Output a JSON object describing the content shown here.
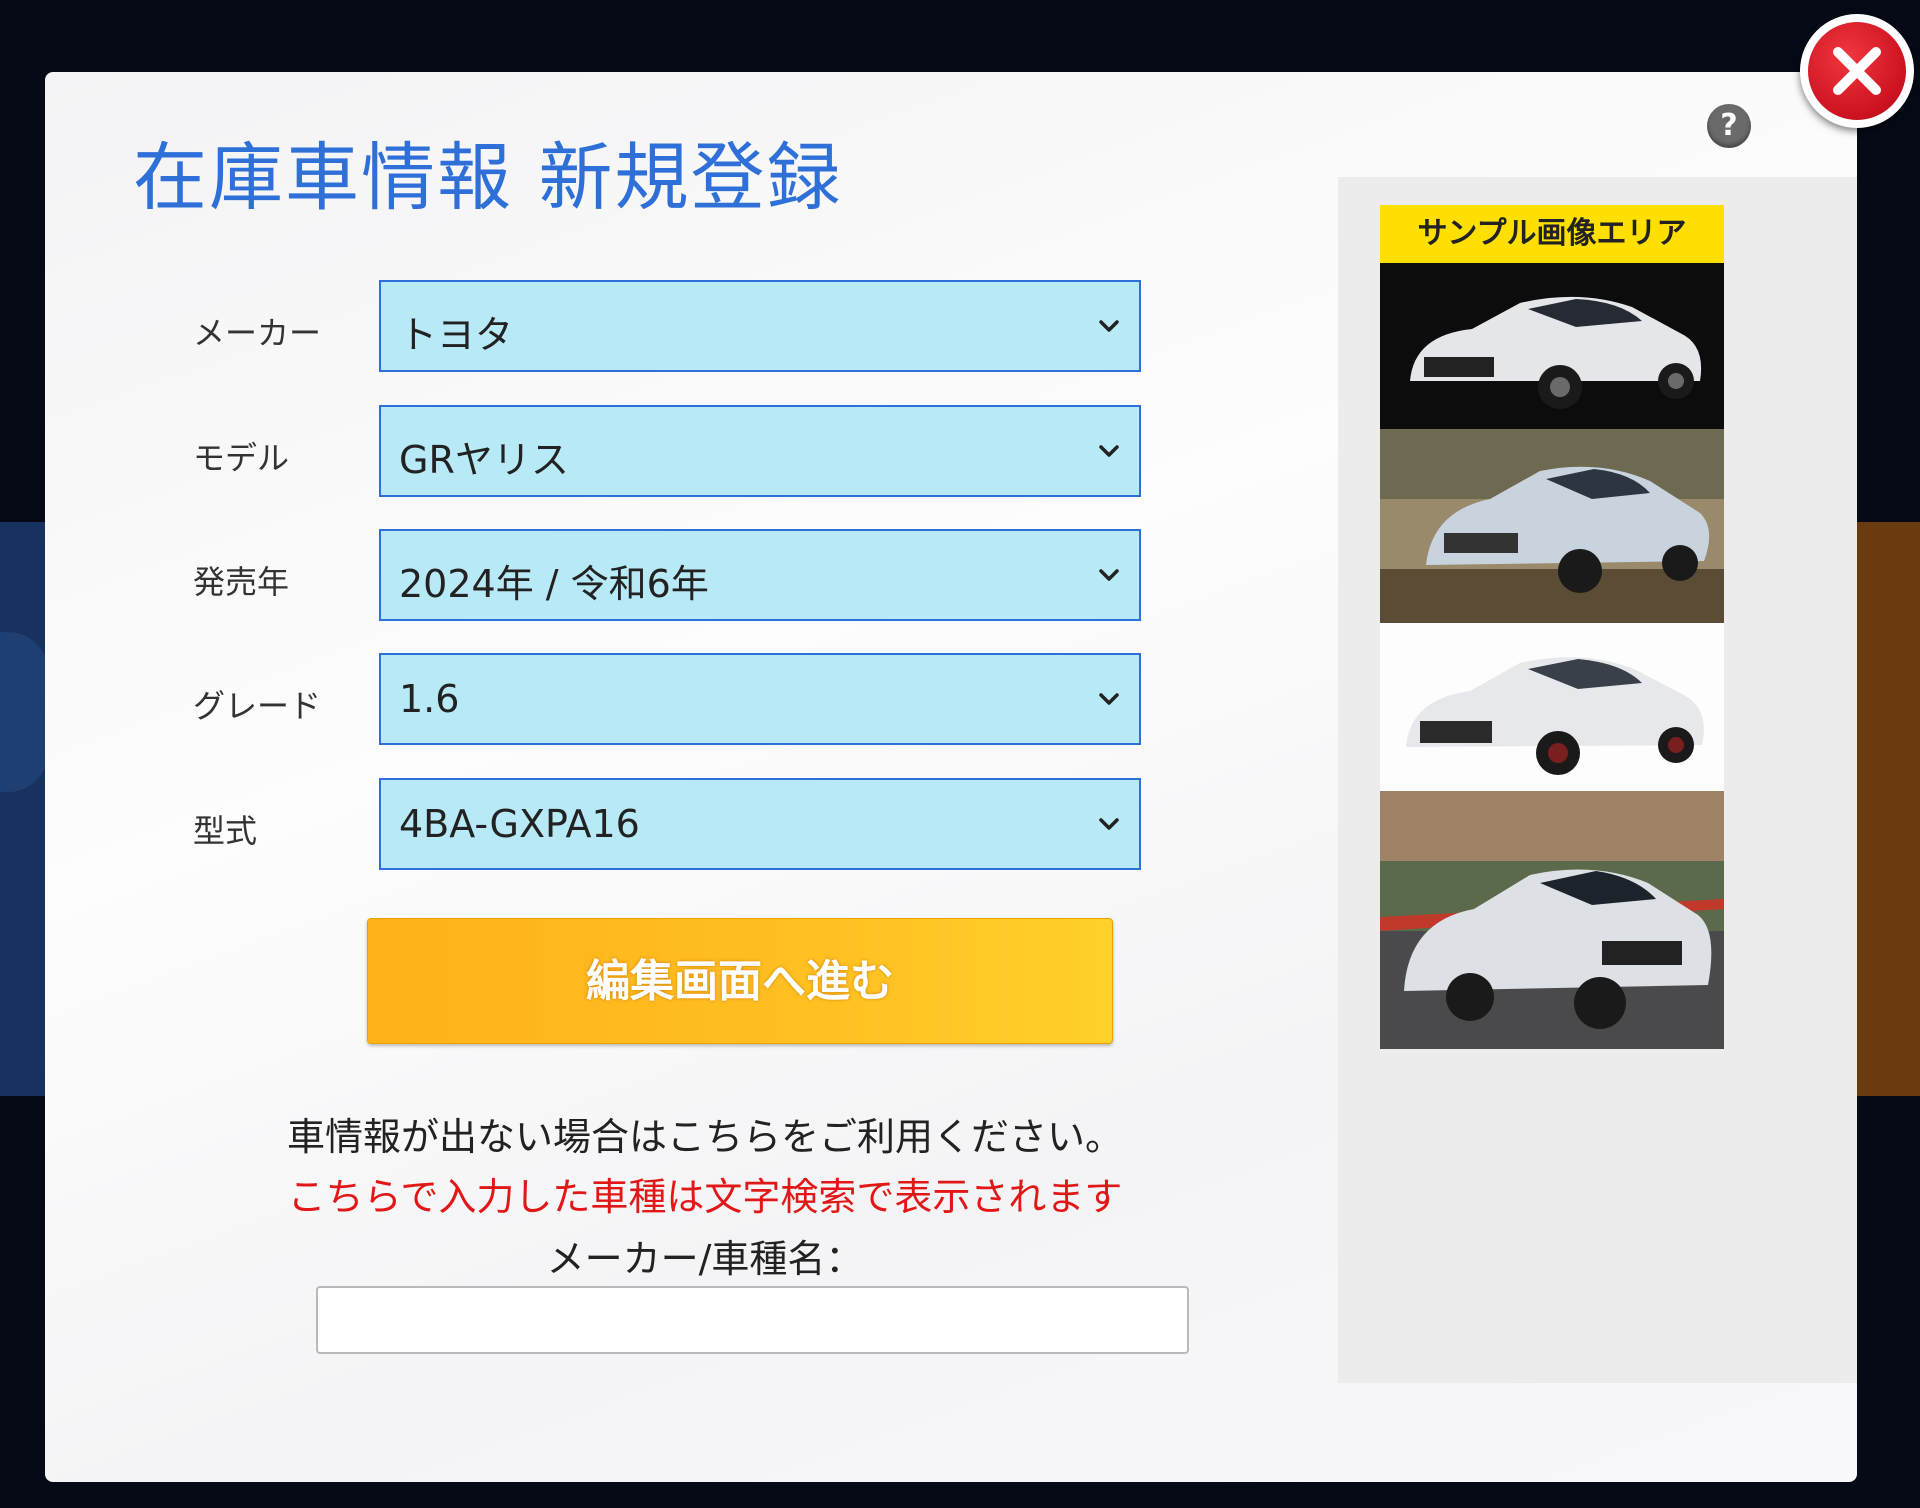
{
  "modal": {
    "title": "在庫車情報 新規登録",
    "help_icon": "?",
    "close_icon": "close-icon"
  },
  "form": {
    "rows": [
      {
        "label": "メーカー",
        "value": "トヨタ"
      },
      {
        "label": "モデル",
        "value": "GRヤリス"
      },
      {
        "label": "発売年",
        "value": "2024年 / 令和6年"
      },
      {
        "label": "グレード",
        "value": "1.6"
      },
      {
        "label": "型式",
        "value": "4BA-GXPA16"
      }
    ],
    "submit_label": "編集画面へ進む"
  },
  "manual": {
    "note": "車情報が出ない場合はこちらをご利用ください。",
    "warning": "こちらで入力した車種は文字検索で表示されます",
    "label": "メーカー/車種名：",
    "value": ""
  },
  "sample": {
    "header": "サンプル画像エリア"
  },
  "colors": {
    "accent": "#2e6fd8",
    "select_bg": "#b8e9f6",
    "button": "#ffb21a",
    "warning": "#e21818",
    "sample_header": "#ffdf00"
  }
}
